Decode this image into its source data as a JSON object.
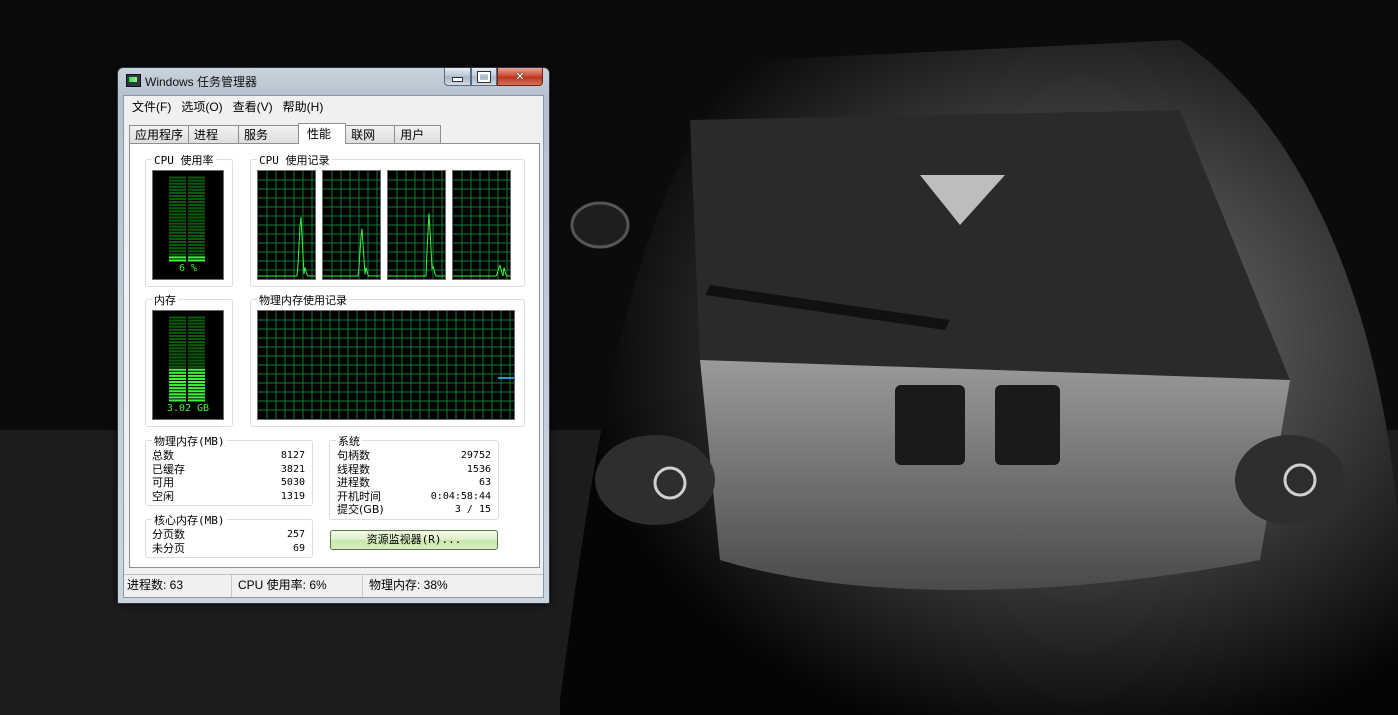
{
  "window": {
    "title": "Windows 任务管理器"
  },
  "menu": [
    "文件(F)",
    "选项(O)",
    "查看(V)",
    "帮助(H)"
  ],
  "tabs": [
    "应用程序",
    "进程",
    "服务",
    "性能",
    "联网",
    "用户"
  ],
  "active_tab": "性能",
  "performance": {
    "cpu_usage_label": "CPU 使用率",
    "cpu_usage_value": "6 %",
    "cpu_usage_fraction": 0.06,
    "cpu_history_label": "CPU 使用记录",
    "memory_label": "内存",
    "memory_value": "3.02 GB",
    "memory_fraction": 0.38,
    "memory_history_label": "物理内存使用记录"
  },
  "physical_memory": {
    "label": "物理内存(MB)",
    "rows": [
      {
        "label": "总数",
        "value": "8127"
      },
      {
        "label": "已缓存",
        "value": "3821"
      },
      {
        "label": "可用",
        "value": "5030"
      },
      {
        "label": "空闲",
        "value": "1319"
      }
    ]
  },
  "kernel_memory": {
    "label": "核心内存(MB)",
    "rows": [
      {
        "label": "分页数",
        "value": "257"
      },
      {
        "label": "未分页",
        "value": "69"
      }
    ]
  },
  "system": {
    "label": "系统",
    "rows": [
      {
        "label": "句柄数",
        "value": "29752"
      },
      {
        "label": "线程数",
        "value": "1536"
      },
      {
        "label": "进程数",
        "value": "63"
      },
      {
        "label": "开机时间",
        "value": "0:04:58:44"
      },
      {
        "label": "提交(GB)",
        "value": "3 / 15"
      }
    ]
  },
  "resource_monitor_button": "资源监视器(R)...",
  "status_bar": {
    "processes": "进程数: 63",
    "cpu": "CPU 使用率: 6%",
    "memory": "物理内存: 38%"
  },
  "colors": {
    "graph_green": "#3ef23e",
    "grid_green": "#0b7a3a",
    "memory_line_blue": "#2b9bd8"
  }
}
